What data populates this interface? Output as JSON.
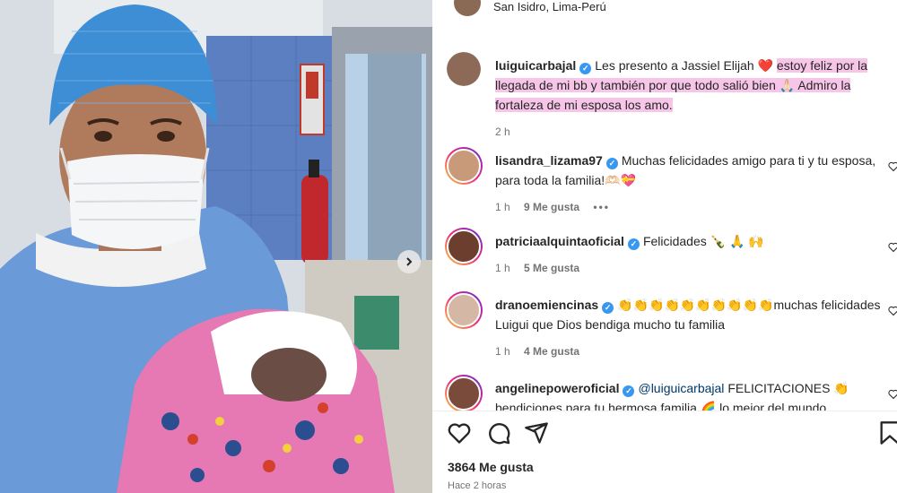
{
  "post": {
    "location": "San Isidro, Lima-Perú",
    "caption": {
      "username": "luiguicarbajal",
      "text_plain": "Les presento a Jassiel Elijah ",
      "emoji_heart": "❤️",
      "text_highlight_1": "estoy feliz por la",
      "text_highlight_2": "llegada de mi bb y también por que todo salió bien 🙏🏻 Admiro la",
      "text_highlight_3": "fortaleza de mi esposa los amo.",
      "time": "2 h"
    },
    "likes_total": "3864 Me gusta",
    "posted_ago": "Hace 2 horas"
  },
  "comments": [
    {
      "username": "lisandra_lizama97",
      "text": "Muchas felicidades amigo para ti y tu esposa, para toda la familia!🫶🏻💝",
      "time": "1 h",
      "likes": "9 Me gusta",
      "more": "•••"
    },
    {
      "username": "patriciaalquintaoficial",
      "text": "Felicidades 🍾 🙏 🙌",
      "time": "1 h",
      "likes": "5 Me gusta"
    },
    {
      "username": "dranoemiencinas",
      "text": "👏👏👏👏👏👏👏👏👏👏muchas felicidades Luigui que Dios bendiga mucho tu familia",
      "time": "1 h",
      "likes": "4 Me gusta"
    },
    {
      "username": "angelinepoweroficial",
      "mention": "@luiguicarbajal",
      "text": "FELICITACIONES 👏 bendiciones para tu hermosa familia 🌈 lo mejor del mundo"
    }
  ],
  "icons": {
    "like": "heart-icon",
    "comment": "comment-icon",
    "share": "share-icon",
    "save": "bookmark-icon",
    "next": "chevron-right-icon",
    "verified": "verified-badge-icon"
  },
  "colors": {
    "verified": "#3897f0",
    "highlight": "#f7c5e8",
    "mention": "#00376b"
  }
}
